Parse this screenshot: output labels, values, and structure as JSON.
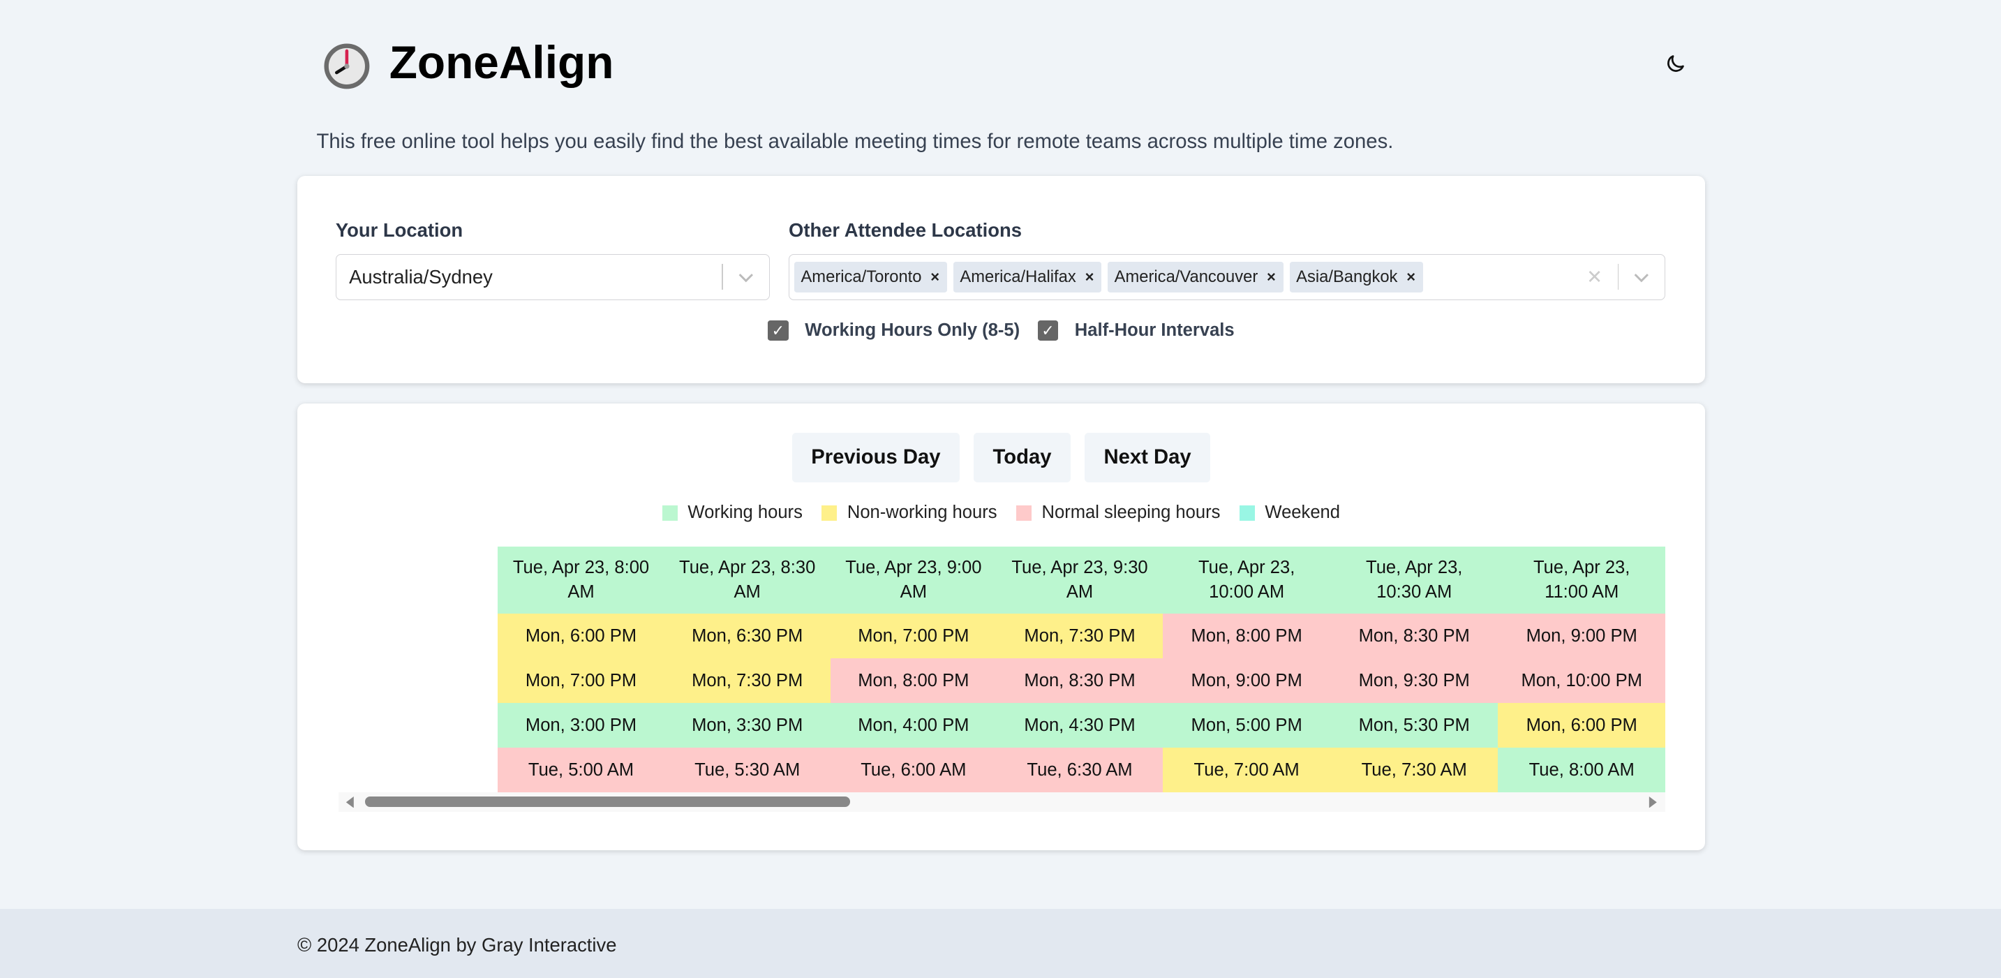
{
  "header": {
    "title": "ZoneAlign",
    "logo_icon": "clock-icon",
    "theme_icon": "moon-icon"
  },
  "description": "This free online tool helps you easily find the best available meeting times for remote teams across multiple time zones.",
  "settings": {
    "your_location_label": "Your Location",
    "your_location_value": "Australia/Sydney",
    "other_label": "Other Attendee Locations",
    "other_locations": [
      "America/Toronto",
      "America/Halifax",
      "America/Vancouver",
      "Asia/Bangkok"
    ],
    "remove_glyph": "×",
    "clear_glyph": "✕",
    "working_hours_only": {
      "label": "Working Hours Only (8-5)",
      "checked": true
    },
    "half_hour": {
      "label": "Half-Hour Intervals",
      "checked": true
    }
  },
  "nav": {
    "prev": "Previous Day",
    "today": "Today",
    "next": "Next Day"
  },
  "legend": [
    {
      "label": "Working hours",
      "color": "#bbf7d0"
    },
    {
      "label": "Non-working hours",
      "color": "#fef08a"
    },
    {
      "label": "Normal sleeping hours",
      "color": "#fecaca"
    },
    {
      "label": "Weekend",
      "color": "#99f6e4"
    }
  ],
  "table": {
    "header": [
      {
        "text": "Tue, Apr 23, 8:00 AM",
        "status": "w"
      },
      {
        "text": "Tue, Apr 23, 8:30 AM",
        "status": "w"
      },
      {
        "text": "Tue, Apr 23, 9:00 AM",
        "status": "w"
      },
      {
        "text": "Tue, Apr 23, 9:30 AM",
        "status": "w"
      },
      {
        "text": "Tue, Apr 23, 10:00 AM",
        "status": "w"
      },
      {
        "text": "Tue, Apr 23, 10:30 AM",
        "status": "w"
      },
      {
        "text": "Tue, Apr 23, 11:00 AM",
        "status": "w"
      }
    ],
    "rows": [
      [
        {
          "text": "Mon, 6:00 PM",
          "status": "n"
        },
        {
          "text": "Mon, 6:30 PM",
          "status": "n"
        },
        {
          "text": "Mon, 7:00 PM",
          "status": "n"
        },
        {
          "text": "Mon, 7:30 PM",
          "status": "n"
        },
        {
          "text": "Mon, 8:00 PM",
          "status": "s"
        },
        {
          "text": "Mon, 8:30 PM",
          "status": "s"
        },
        {
          "text": "Mon, 9:00 PM",
          "status": "s"
        }
      ],
      [
        {
          "text": "Mon, 7:00 PM",
          "status": "n"
        },
        {
          "text": "Mon, 7:30 PM",
          "status": "n"
        },
        {
          "text": "Mon, 8:00 PM",
          "status": "s"
        },
        {
          "text": "Mon, 8:30 PM",
          "status": "s"
        },
        {
          "text": "Mon, 9:00 PM",
          "status": "s"
        },
        {
          "text": "Mon, 9:30 PM",
          "status": "s"
        },
        {
          "text": "Mon, 10:00 PM",
          "status": "s"
        }
      ],
      [
        {
          "text": "Mon, 3:00 PM",
          "status": "w"
        },
        {
          "text": "Mon, 3:30 PM",
          "status": "w"
        },
        {
          "text": "Mon, 4:00 PM",
          "status": "w"
        },
        {
          "text": "Mon, 4:30 PM",
          "status": "w"
        },
        {
          "text": "Mon, 5:00 PM",
          "status": "w"
        },
        {
          "text": "Mon, 5:30 PM",
          "status": "w"
        },
        {
          "text": "Mon, 6:00 PM",
          "status": "n"
        }
      ],
      [
        {
          "text": "Tue, 5:00 AM",
          "status": "s"
        },
        {
          "text": "Tue, 5:30 AM",
          "status": "s"
        },
        {
          "text": "Tue, 6:00 AM",
          "status": "s"
        },
        {
          "text": "Tue, 6:30 AM",
          "status": "s"
        },
        {
          "text": "Tue, 7:00 AM",
          "status": "n"
        },
        {
          "text": "Tue, 7:30 AM",
          "status": "n"
        },
        {
          "text": "Tue, 8:00 AM",
          "status": "w"
        }
      ]
    ]
  },
  "footer": "© 2024 ZoneAlign by Gray Interactive"
}
